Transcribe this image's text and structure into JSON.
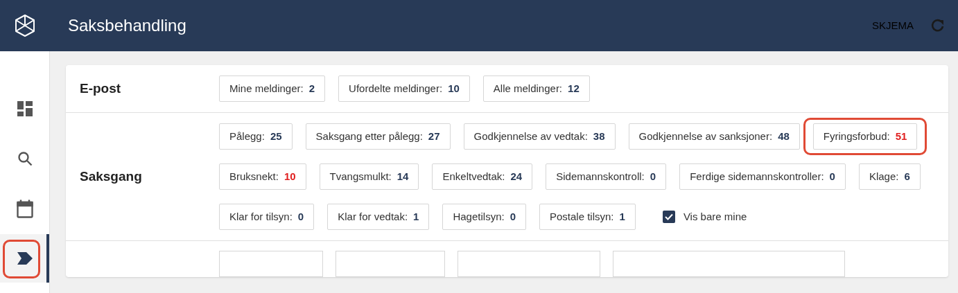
{
  "header": {
    "title": "Saksbehandling",
    "action": "SKJEMA"
  },
  "nav": [
    {
      "selected": false,
      "highlighted": false
    },
    {
      "selected": false,
      "highlighted": false
    },
    {
      "selected": false,
      "highlighted": false
    },
    {
      "selected": true,
      "highlighted": true
    }
  ],
  "sections": [
    {
      "title": "E-post",
      "items": [
        {
          "kind": "chip",
          "label": "Mine meldinger:",
          "count": "2",
          "alert": false,
          "highlighted": false
        },
        {
          "kind": "chip",
          "label": "Ufordelte meldinger:",
          "count": "10",
          "alert": false,
          "highlighted": false
        },
        {
          "kind": "chip",
          "label": "Alle meldinger:",
          "count": "12",
          "alert": false,
          "highlighted": false
        }
      ]
    },
    {
      "title": "Saksgang",
      "items": [
        {
          "kind": "chip",
          "label": "Pålegg:",
          "count": "25",
          "alert": false,
          "highlighted": false
        },
        {
          "kind": "chip",
          "label": "Saksgang etter pålegg:",
          "count": "27",
          "alert": false,
          "highlighted": false
        },
        {
          "kind": "chip",
          "label": "Godkjennelse av vedtak:",
          "count": "38",
          "alert": false,
          "highlighted": false
        },
        {
          "kind": "chip",
          "label": "Godkjennelse av sanksjoner:",
          "count": "48",
          "alert": false,
          "highlighted": false
        },
        {
          "kind": "chip",
          "label": "Fyringsforbud:",
          "count": "51",
          "alert": true,
          "highlighted": true
        },
        {
          "kind": "chip",
          "label": "Bruksnekt:",
          "count": "10",
          "alert": true,
          "highlighted": false
        },
        {
          "kind": "chip",
          "label": "Tvangsmulkt:",
          "count": "14",
          "alert": false,
          "highlighted": false
        },
        {
          "kind": "chip",
          "label": "Enkeltvedtak:",
          "count": "24",
          "alert": false,
          "highlighted": false
        },
        {
          "kind": "chip",
          "label": "Sidemannskontroll:",
          "count": "0",
          "alert": false,
          "highlighted": false
        },
        {
          "kind": "chip",
          "label": "Ferdige sidemannskontroller:",
          "count": "0",
          "alert": false,
          "highlighted": false
        },
        {
          "kind": "chip",
          "label": "Klage:",
          "count": "6",
          "alert": false,
          "highlighted": false
        },
        {
          "kind": "chip",
          "label": "Klar for tilsyn:",
          "count": "0",
          "alert": false,
          "highlighted": false
        },
        {
          "kind": "chip",
          "label": "Klar for vedtak:",
          "count": "1",
          "alert": false,
          "highlighted": false
        },
        {
          "kind": "chip",
          "label": "Hagetilsyn:",
          "count": "0",
          "alert": false,
          "highlighted": false
        },
        {
          "kind": "chip",
          "label": "Postale tilsyn:",
          "count": "1",
          "alert": false,
          "highlighted": false
        },
        {
          "kind": "checkbox",
          "label": "Vis bare mine",
          "checked": true
        }
      ]
    }
  ]
}
